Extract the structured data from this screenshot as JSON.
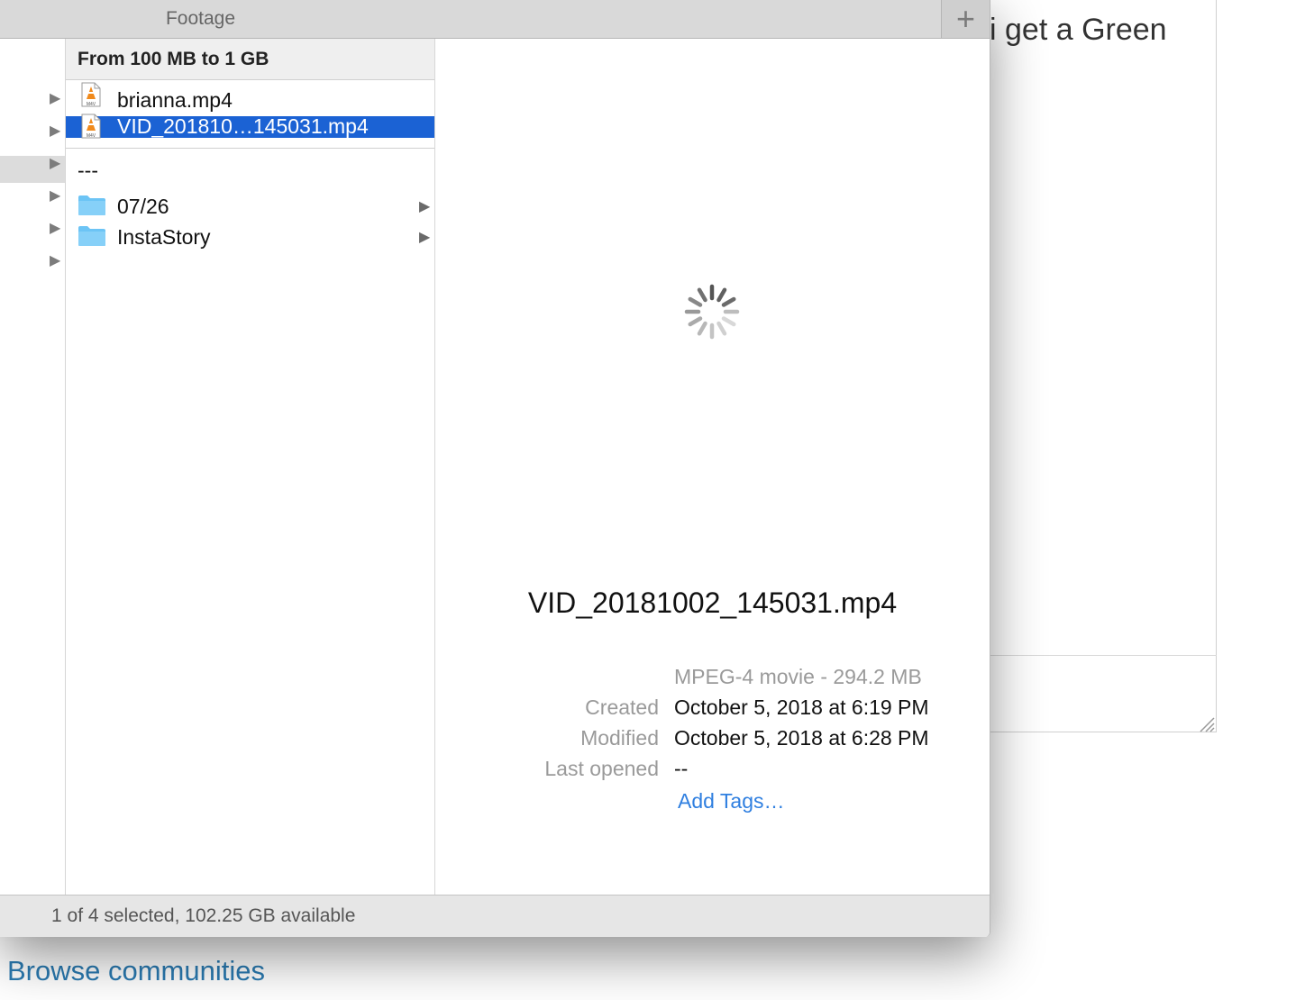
{
  "window": {
    "tab_title": "Footage",
    "add_tab_symbol": "+",
    "status": "1 of 4 selected, 102.25 GB available"
  },
  "column1": {
    "header": "From 100 MB to 1 GB",
    "items": [
      {
        "label": "brianna.mp4",
        "type": "m4v-file",
        "selected": false
      },
      {
        "label": "VID_201810…145031.mp4",
        "type": "m4v-file",
        "selected": true
      },
      {
        "label": "---",
        "type": "separator-item",
        "selected": false
      },
      {
        "label": "07/26",
        "type": "folder",
        "selected": false
      },
      {
        "label": "InstaStory",
        "type": "folder",
        "selected": false
      }
    ]
  },
  "preview": {
    "filename": "VID_20181002_145031.mp4",
    "kind_size": "MPEG-4 movie - 294.2 MB",
    "created_label": "Created",
    "created_value": "October 5, 2018 at 6:19 PM",
    "modified_label": "Modified",
    "modified_value": "October 5, 2018 at 6:28 PM",
    "last_opened_label": "Last opened",
    "last_opened_value": "--",
    "add_tags": "Add Tags…"
  },
  "background": {
    "partial_text": "i get a Green",
    "browse_link": "Browse communities"
  },
  "colors": {
    "selection": "#1b62d4",
    "link": "#2f7fe0",
    "folder": "#6cc4f5"
  },
  "icons": [
    "disclosure-arrow-icon",
    "m4v-file-icon",
    "folder-icon",
    "chevron-right-icon",
    "loading-spinner-icon",
    "plus-icon",
    "resize-grip-icon"
  ]
}
